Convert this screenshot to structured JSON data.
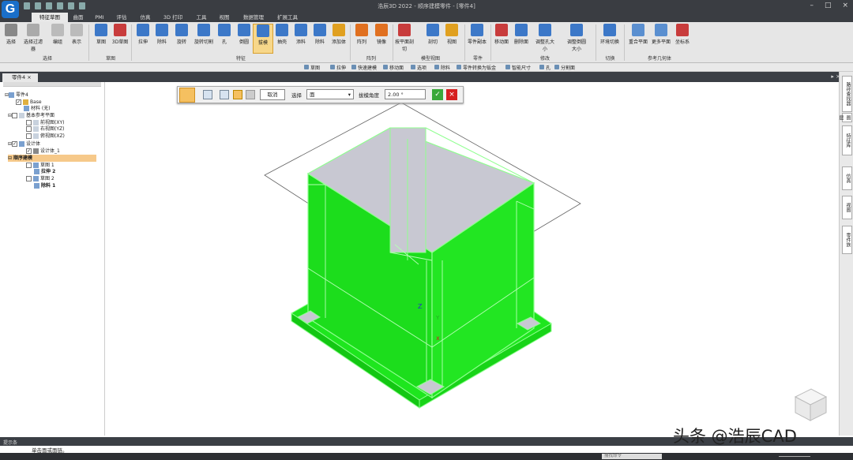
{
  "app": {
    "window_title": "浩辰3D 2022 - 顺序建模零件 - [零件4]",
    "logo_letter": "G"
  },
  "menu_tabs": [
    "特征草图",
    "曲面",
    "PMI",
    "评估",
    "仿真",
    "3D 打印",
    "工具",
    "视图",
    "数据管理",
    "扩展工具"
  ],
  "ribbon": {
    "buttons": [
      {
        "label": "选择",
        "color": "#888"
      },
      {
        "label": "选择过滤器",
        "color": "#aaa"
      },
      {
        "label": "编组",
        "color": "#bbb"
      },
      {
        "label": "表示",
        "color": "#bbb"
      },
      {
        "label": "草图",
        "color": "#3c78c8"
      },
      {
        "label": "3D草图",
        "color": "#c83c3c"
      },
      {
        "label": "拉伸",
        "color": "#3c78c8"
      },
      {
        "label": "除料",
        "color": "#3c78c8"
      },
      {
        "label": "旋转",
        "color": "#3c78c8"
      },
      {
        "label": "旋转切割",
        "color": "#3c78c8"
      },
      {
        "label": "孔",
        "color": "#3c78c8"
      },
      {
        "label": "倒圆",
        "color": "#3c78c8"
      },
      {
        "label": "拔模",
        "color": "#3c78c8"
      },
      {
        "label": "抽壳",
        "color": "#3c78c8"
      },
      {
        "label": "添料",
        "color": "#3c78c8"
      },
      {
        "label": "除料",
        "color": "#3c78c8"
      },
      {
        "label": "添加体",
        "color": "#e0a020"
      },
      {
        "label": "阵列",
        "color": "#e07020"
      },
      {
        "label": "镜像",
        "color": "#e07020"
      },
      {
        "label": "按平面剖切",
        "color": "#c83c3c"
      },
      {
        "label": "剖切",
        "color": "#3c78c8"
      },
      {
        "label": "视图",
        "color": "#e0a020"
      },
      {
        "label": "零件副本",
        "color": "#3c78c8"
      },
      {
        "label": "移动面",
        "color": "#c83c3c"
      },
      {
        "label": "删除面",
        "color": "#3c78c8"
      },
      {
        "label": "调整孔大小",
        "color": "#3c78c8"
      },
      {
        "label": "调整倒圆大小",
        "color": "#3c78c8"
      },
      {
        "label": "环境切换",
        "color": "#3c78c8"
      },
      {
        "label": "重合平面",
        "color": "#5a8fd0"
      },
      {
        "label": "更多平面",
        "color": "#5a8fd0"
      },
      {
        "label": "坐标系",
        "color": "#c83c3c"
      }
    ],
    "groups": [
      "选择",
      "草图",
      "特征",
      "阵列",
      "模型视图",
      "零件",
      "修改",
      "切换",
      "参考几何体"
    ]
  },
  "command_bar": [
    "草图",
    "拉伸",
    "快速建模",
    "移动面",
    "选项",
    "除料",
    "零件转换为钣金",
    "智能尺寸",
    "孔",
    "分割面"
  ],
  "doc_tab": {
    "label": "零件4",
    "close": "×"
  },
  "tree": {
    "root": "零件4",
    "base": "Base",
    "material": "材料 (无)",
    "ref_planes": "基本参考平面",
    "planes": [
      "前视图(XY)",
      "右视图(YZ)",
      "俯视图(XZ)"
    ],
    "design_body": "设计体",
    "design_body_1": "设计体_1",
    "sequential": "顺序建模",
    "sketch1": "草图 1",
    "extrude2": "拉伸 2",
    "sketch2": "草图 2",
    "cut1": "除料 1"
  },
  "draft_toolbar": {
    "cancel": "取消",
    "select_label": "选择",
    "select_value": "面",
    "angle_label": "拔模角度",
    "angle_value": "2.00 °"
  },
  "right_tabs": [
    "路径查找器",
    "图层",
    "特征库",
    "仿真",
    "视图",
    "零件族"
  ],
  "status": {
    "prompt_label": "提示条",
    "prompt_text": "单击面或面链。",
    "search_placeholder": "搜找命令"
  },
  "watermark": "头条 @浩辰CAD",
  "colors": {
    "part_green": "#1ee61e",
    "part_gray": "#c8c8d2",
    "dark_chrome": "#3a3d42"
  }
}
